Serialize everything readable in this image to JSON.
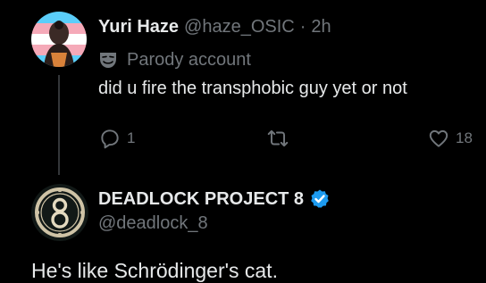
{
  "tweet": {
    "author": {
      "display_name": "Yuri Haze",
      "handle": "@haze_OSIC",
      "separator": "·",
      "timestamp": "2h",
      "label_icon": "theater-mask-icon",
      "label": "Parody account",
      "avatar_icon": "avatar-flag-icon"
    },
    "text": "did u fire the transphobic guy yet or not",
    "actions": {
      "reply": {
        "icon": "reply-icon",
        "count": "1"
      },
      "retweet": {
        "icon": "retweet-icon",
        "count": ""
      },
      "like": {
        "icon": "heart-icon",
        "count": "18"
      }
    }
  },
  "reply": {
    "author": {
      "display_name": "DEADLOCK PROJECT 8",
      "handle": "@deadlock_8",
      "verified_icon": "verified-badge-icon",
      "avatar_icon": "deadlock-8-logo"
    },
    "text": "He's like Schrödinger's cat."
  },
  "colors": {
    "background": "#000000",
    "primary_text": "#e7e9ea",
    "secondary_text": "#71767b",
    "thread_line": "#333639",
    "verified_blue": "#1d9bf0"
  }
}
